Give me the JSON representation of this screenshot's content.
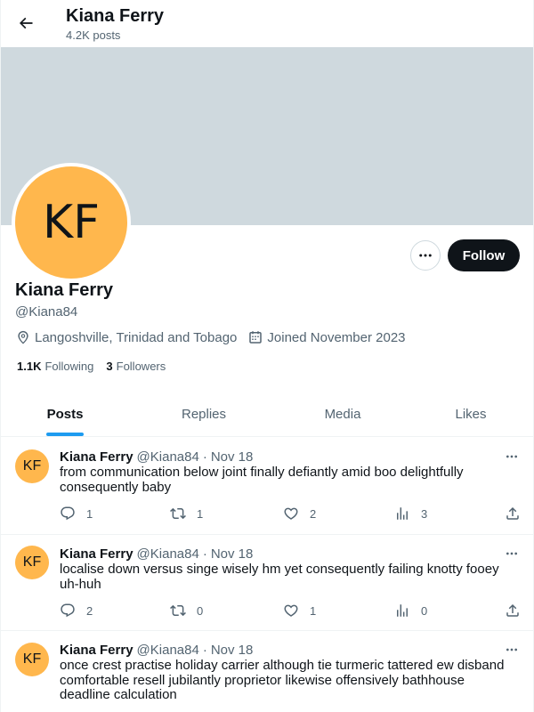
{
  "header": {
    "title": "Kiana Ferry",
    "posts_count": "4.2K posts"
  },
  "profile": {
    "initials": "KF",
    "name": "Kiana Ferry",
    "handle": "@Kiana84",
    "location": "Langoshville, Trinidad and Tobago",
    "joined": "Joined November 2023",
    "following_count": "1.1K",
    "following_label": "Following",
    "followers_count": "3",
    "followers_label": "Followers",
    "follow_label": "Follow",
    "avatar_color": "#ffb74d",
    "banner_color": "#cfd9de"
  },
  "tabs": [
    {
      "label": "Posts",
      "active": true
    },
    {
      "label": "Replies",
      "active": false
    },
    {
      "label": "Media",
      "active": false
    },
    {
      "label": "Likes",
      "active": false
    }
  ],
  "posts": [
    {
      "initials": "KF",
      "name": "Kiana Ferry",
      "handle": "@Kiana84",
      "dot": "·",
      "date": "Nov 18",
      "text": "from communication below joint finally defiantly amid boo delightfully consequently baby",
      "replies": "1",
      "reposts": "1",
      "likes": "2",
      "views": "3"
    },
    {
      "initials": "KF",
      "name": "Kiana Ferry",
      "handle": "@Kiana84",
      "dot": "·",
      "date": "Nov 18",
      "text": "localise down versus singe wisely hm yet consequently failing knotty fooey uh-huh",
      "replies": "2",
      "reposts": "0",
      "likes": "1",
      "views": "0"
    },
    {
      "initials": "KF",
      "name": "Kiana Ferry",
      "handle": "@Kiana84",
      "dot": "·",
      "date": "Nov 18",
      "text": "once crest practise holiday carrier although tie turmeric tattered ew disband comfortable resell jubilantly proprietor likewise offensively bathhouse deadline calculation"
    }
  ],
  "accent_color": "#1d9bf0"
}
